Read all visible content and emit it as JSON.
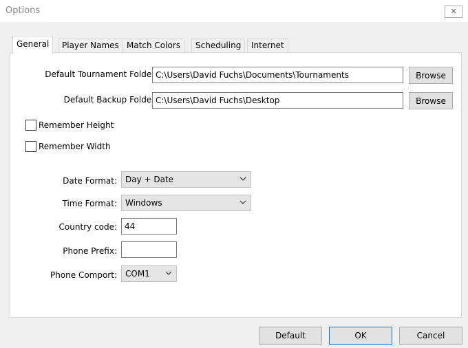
{
  "window": {
    "title": "Options",
    "close_glyph": "✕"
  },
  "tabs": [
    {
      "label": "General",
      "active": true
    },
    {
      "label": "Player Names"
    },
    {
      "label": "Match Colors"
    },
    {
      "label": "Scheduling"
    },
    {
      "label": "Internet"
    }
  ],
  "general": {
    "tournament_folder": {
      "label": "Default Tournament Folder:",
      "value": "C:\\Users\\David Fuchs\\Documents\\Tournaments",
      "browse_label": "Browse"
    },
    "backup_folder": {
      "label": "Default Backup Folder:",
      "value": "C:\\Users\\David Fuchs\\Desktop",
      "browse_label": "Browse"
    },
    "remember_height": {
      "label": "Remember Height",
      "checked": false
    },
    "remember_width": {
      "label": "Remember Width",
      "checked": false
    },
    "date_format": {
      "label": "Date Format:",
      "value": "Day + Date"
    },
    "time_format": {
      "label": "Time Format:",
      "value": "Windows"
    },
    "country_code": {
      "label": "Country code:",
      "value": "44"
    },
    "phone_prefix": {
      "label": "Phone Prefix:",
      "value": ""
    },
    "phone_comport": {
      "label": "Phone Comport:",
      "value": "COM1"
    }
  },
  "footer": {
    "default_label": "Default",
    "ok_label": "OK",
    "cancel_label": "Cancel"
  },
  "icons": {
    "chevron": "chevron-down-icon",
    "close": "close-icon"
  }
}
